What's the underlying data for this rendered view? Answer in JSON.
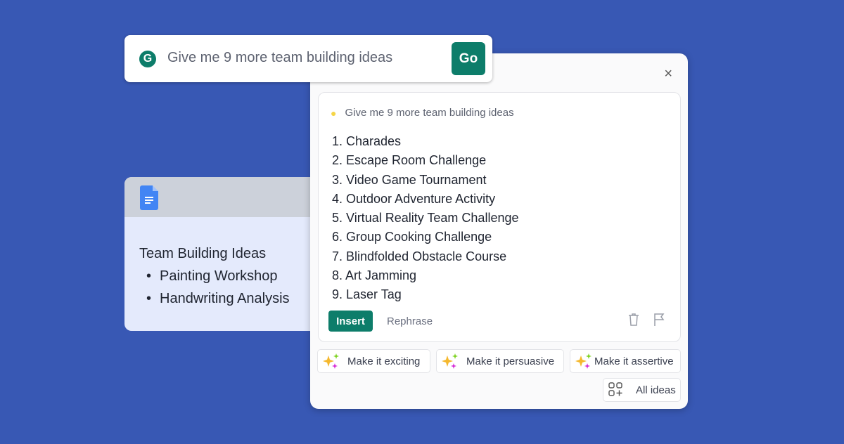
{
  "search": {
    "query": "Give me 9 more team building ideas",
    "go_label": "Go"
  },
  "doc": {
    "title": "Team Building Ideas",
    "bullets": [
      "Painting Workshop",
      "Handwriting Analysis"
    ]
  },
  "panel": {
    "prompt": "Give me 9 more team building ideas",
    "items": [
      "1. Charades",
      "2. Escape Room Challenge",
      "3. Video Game Tournament",
      "4. Outdoor Adventure Activity",
      "5. Virtual Reality Team Challenge",
      "6. Group Cooking Challenge",
      "7. Blindfolded Obstacle Course",
      "8. Art Jamming",
      "9. Laser Tag"
    ],
    "insert_label": "Insert",
    "rephrase_label": "Rephrase",
    "chips": [
      "Make it exciting",
      "Make it persuasive",
      "Make it assertive"
    ],
    "all_ideas_label": "All ideas",
    "close_icon": "×"
  },
  "colors": {
    "background": "#3858b4",
    "accent": "#0d7d6a"
  }
}
